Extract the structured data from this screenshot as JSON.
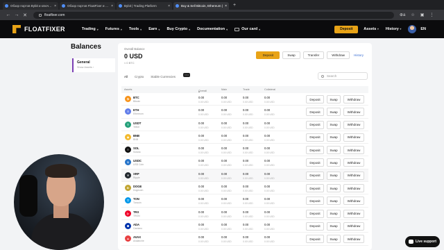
{
  "browser": {
    "tabs": [
      {
        "label": "Обзор портов Bybit и ключевы"
      },
      {
        "label": "Обзор портов FloatFixer и клю"
      },
      {
        "label": "Bybit | Trading Platform"
      },
      {
        "label": "Buy & Sell Bitcoin, Ethereum |"
      }
    ],
    "active_tab": 3,
    "url": "floatfixer.com",
    "zoom": "⊕a"
  },
  "header": {
    "brand": "FLOATFIXER",
    "nav": [
      "Trading",
      "Futures",
      "Tools",
      "Earn",
      "Buy Crypto",
      "Documentation",
      "Our card"
    ],
    "deposit_label": "Deposit",
    "assets_label": "Assets",
    "history_label": "History",
    "language": "EN"
  },
  "page": {
    "title": "Balances",
    "side": {
      "general": "General",
      "show_assets": "Show Assets"
    }
  },
  "overview": {
    "label": "Overall Balance",
    "value": "0 USD",
    "btc": "≈ 0 BTC",
    "actions": {
      "deposit": "Deposit",
      "swap": "Swap",
      "transfer": "Transfer",
      "withdraw": "Withdraw",
      "history": "History"
    }
  },
  "filters": {
    "all": "All",
    "crypto": "Crypto",
    "stable": "Stable Currencies",
    "new_badge": "New"
  },
  "search": {
    "placeholder": "Search"
  },
  "table": {
    "headers": {
      "assets": "Assets",
      "overall": "Overall",
      "main": "Main",
      "trade": "Trade",
      "collateral": "Collateral"
    },
    "row_buttons": {
      "deposit": "Deposit",
      "swap": "Swap",
      "withdraw": "Withdraw"
    },
    "rows": [
      {
        "symbol": "BTC",
        "name": "Bitcoin",
        "color": "#f7931a",
        "glyph": "₿",
        "overall": "0.00",
        "overall_usd": "0.00 USD",
        "main": "0.00",
        "main_usd": "0.00 USD",
        "trade": "0.00",
        "trade_usd": "0.00 USD",
        "collateral": "0.00",
        "collateral_usd": "0.00 USD"
      },
      {
        "symbol": "ETH",
        "name": "Ethereum",
        "color": "#627eea",
        "glyph": "Ξ",
        "overall": "0.00",
        "overall_usd": "0.00 USD",
        "main": "0.00",
        "main_usd": "0.00 USD",
        "trade": "0.00",
        "trade_usd": "0.00 USD",
        "collateral": "0.00",
        "collateral_usd": "0.00 USD"
      },
      {
        "symbol": "USDT",
        "name": "Tether",
        "color": "#26a17b",
        "glyph": "T",
        "overall": "0.00",
        "overall_usd": "0.00 USD",
        "main": "0.00",
        "main_usd": "0.00 USD",
        "trade": "0.00",
        "trade_usd": "0.00 USD",
        "collateral": "0.00",
        "collateral_usd": "0.00 USD"
      },
      {
        "symbol": "BNB",
        "name": "BNB",
        "color": "#f3ba2f",
        "glyph": "◆",
        "overall": "0.00",
        "overall_usd": "0.00 USD",
        "main": "0.00",
        "main_usd": "0.00 USD",
        "trade": "0.00",
        "trade_usd": "0.00 USD",
        "collateral": "0.00",
        "collateral_usd": "0.00 USD"
      },
      {
        "symbol": "SOL",
        "name": "Solana",
        "color": "#111111",
        "glyph": "≡",
        "overall": "0.00",
        "overall_usd": "0.00 USD",
        "main": "0.00",
        "main_usd": "0.00 USD",
        "trade": "0.00",
        "trade_usd": "0.00 USD",
        "collateral": "0.00",
        "collateral_usd": "0.00 USD"
      },
      {
        "symbol": "USDC",
        "name": "USD Coin",
        "color": "#2775ca",
        "glyph": "$",
        "overall": "0.00",
        "overall_usd": "0.00 USD",
        "main": "0.00",
        "main_usd": "0.00 USD",
        "trade": "0.00",
        "trade_usd": "0.00 USD",
        "collateral": "0.00",
        "collateral_usd": "0.00 USD"
      },
      {
        "symbol": "XRP",
        "name": "Ripple",
        "color": "#23292f",
        "glyph": "✕",
        "overall": "0.00",
        "overall_usd": "0.00 USD",
        "main": "0.00",
        "main_usd": "0.00 USD",
        "trade": "0.00",
        "trade_usd": "0.00 USD",
        "collateral": "0.00",
        "collateral_usd": "0.00 USD"
      },
      {
        "symbol": "DOGE",
        "name": "Dogecoin",
        "color": "#c2a633",
        "glyph": "Ð",
        "overall": "0.00",
        "overall_usd": "0.00 USD",
        "main": "0.00",
        "main_usd": "0.00 USD",
        "trade": "0.00",
        "trade_usd": "0.00 USD",
        "collateral": "0.00",
        "collateral_usd": "0.00 USD"
      },
      {
        "symbol": "TON",
        "name": "Toncoin",
        "color": "#0098ea",
        "glyph": "▽",
        "overall": "0.00",
        "overall_usd": "0.00 USD",
        "main": "0.00",
        "main_usd": "0.00 USD",
        "trade": "0.00",
        "trade_usd": "0.00 USD",
        "collateral": "0.00",
        "collateral_usd": "0.00 USD"
      },
      {
        "symbol": "TRX",
        "name": "TRON",
        "color": "#ef0027",
        "glyph": "▷",
        "overall": "0.00",
        "overall_usd": "0.00 USD",
        "main": "0.00",
        "main_usd": "0.00 USD",
        "trade": "0.00",
        "trade_usd": "0.00 USD",
        "collateral": "0.00",
        "collateral_usd": "0.00 USD"
      },
      {
        "symbol": "ADA",
        "name": "Cardano",
        "color": "#0033ad",
        "glyph": "✺",
        "overall": "0.00",
        "overall_usd": "0.00 USD",
        "main": "0.00",
        "main_usd": "0.00 USD",
        "trade": "0.00",
        "trade_usd": "0.00 USD",
        "collateral": "0.00",
        "collateral_usd": "0.00 USD"
      },
      {
        "symbol": "AVAX",
        "name": "Avalanche",
        "color": "#e84142",
        "glyph": "▲",
        "overall": "0.00",
        "overall_usd": "0.00 USD",
        "main": "0.00",
        "main_usd": "0.00 USD",
        "trade": "0.00",
        "trade_usd": "0.00 USD",
        "collateral": "0.00",
        "collateral_usd": "0.00 USD"
      }
    ]
  },
  "live_support": "Live support"
}
